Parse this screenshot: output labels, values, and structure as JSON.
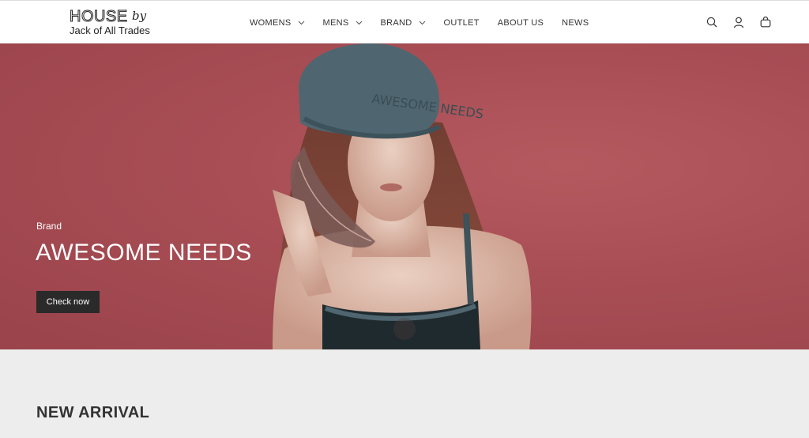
{
  "header": {
    "logo": {
      "house": "HOUSE",
      "by": "by",
      "subtitle": "Jack of All Trades"
    },
    "nav": [
      {
        "label": "WOMENS",
        "has_dropdown": true
      },
      {
        "label": "MENS",
        "has_dropdown": true
      },
      {
        "label": "BRAND",
        "has_dropdown": true
      },
      {
        "label": "OUTLET",
        "has_dropdown": false
      },
      {
        "label": "ABOUT US",
        "has_dropdown": false
      },
      {
        "label": "NEWS",
        "has_dropdown": false
      }
    ],
    "icons": [
      "search-icon",
      "account-icon",
      "cart-icon"
    ]
  },
  "hero": {
    "eyebrow": "Brand",
    "title": "AWESOME NEEDS",
    "cta_label": "Check now",
    "background_color": "#a84d54"
  },
  "section": {
    "title": "NEW ARRIVAL"
  },
  "colors": {
    "button_bg": "#2a2a2a",
    "section_bg": "#ededed"
  }
}
